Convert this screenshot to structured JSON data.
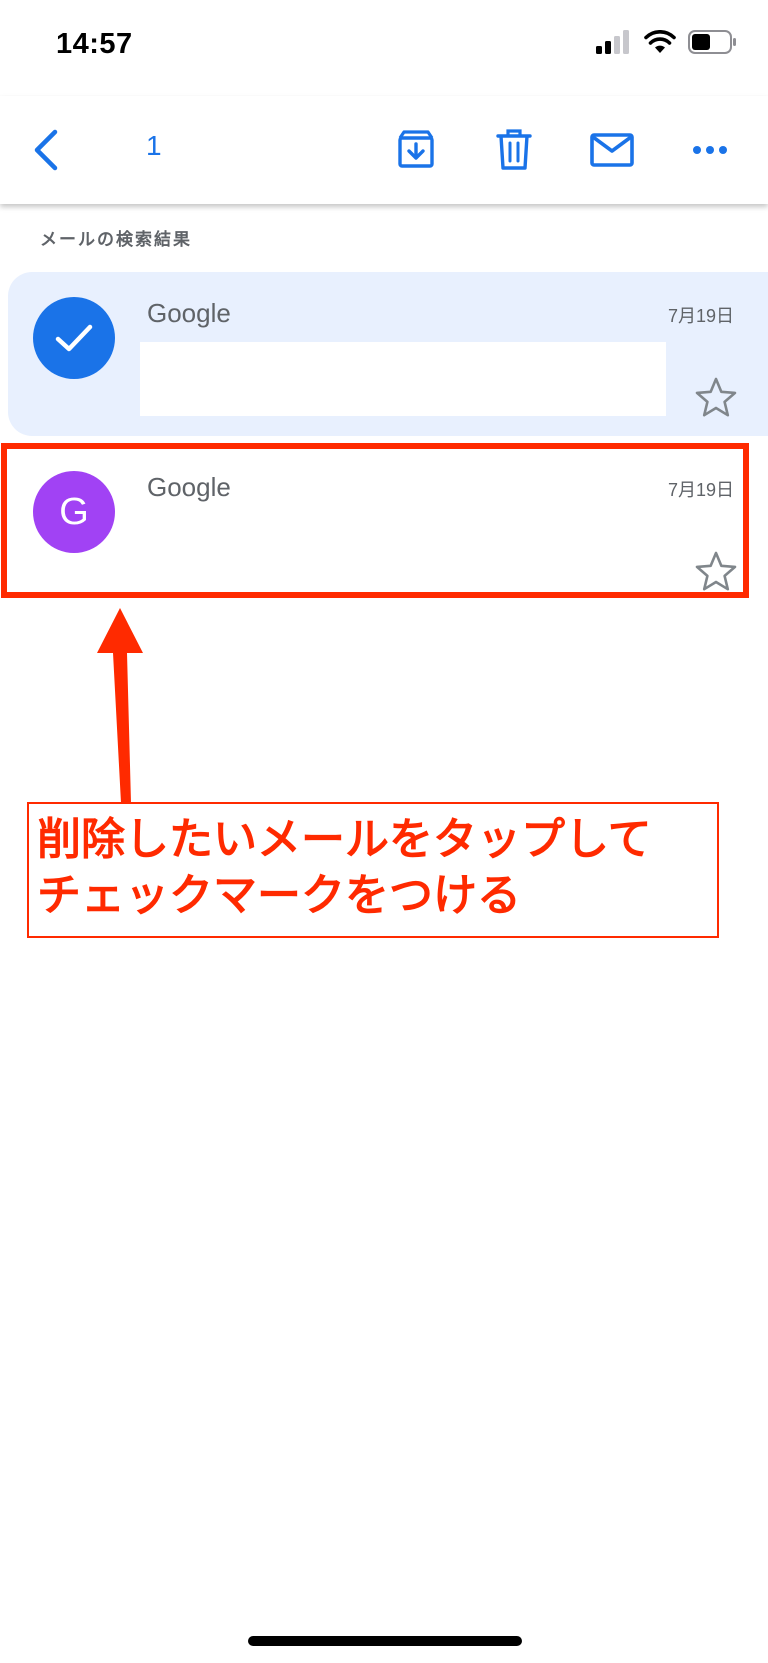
{
  "status_bar": {
    "time": "14:57",
    "battery_level": 0.5
  },
  "toolbar": {
    "selected_count": "1"
  },
  "section": {
    "label": "メールの検索結果"
  },
  "messages": [
    {
      "sender": "Google",
      "date": "7月19日",
      "avatar_letter": "",
      "avatar_color": "#1a73e8",
      "selected": true,
      "starred": false
    },
    {
      "sender": "Google",
      "date": "7月19日",
      "avatar_letter": "G",
      "avatar_color": "#a142f4",
      "selected": false,
      "starred": false
    }
  ],
  "annotation": {
    "text": "削除したいメールをタップして\nチェックマークをつける",
    "color": "#ff2a00"
  },
  "colors": {
    "accent": "#1a73e8",
    "selected_row_bg": "#e8f0fe",
    "annotation_red": "#ff2a00"
  }
}
